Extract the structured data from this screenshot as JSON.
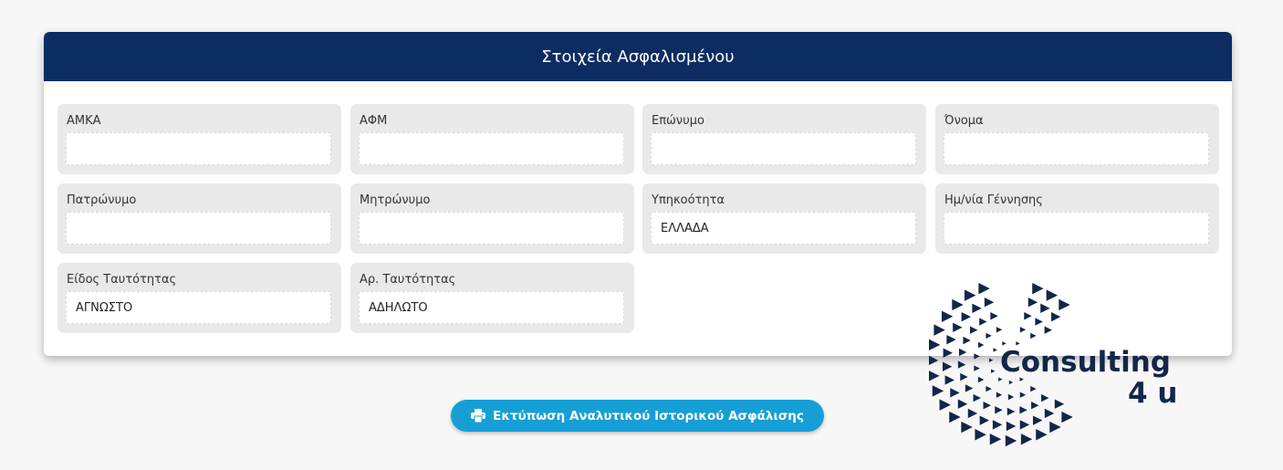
{
  "panel": {
    "title": "Στοιχεία Ασφαλισμένου"
  },
  "fields": [
    {
      "label": "ΑΜΚΑ",
      "value": ""
    },
    {
      "label": "ΑΦΜ",
      "value": ""
    },
    {
      "label": "Επώνυμο",
      "value": ""
    },
    {
      "label": "Όνομα",
      "value": ""
    },
    {
      "label": "Πατρώνυμο",
      "value": ""
    },
    {
      "label": "Μητρώνυμο",
      "value": ""
    },
    {
      "label": "Υπηκοότητα",
      "value": "ΕΛΛΑΔΑ"
    },
    {
      "label": "Ημ/νία Γέννησης",
      "value": ""
    },
    {
      "label": "Είδος Ταυτότητας",
      "value": "ΑΓΝΩΣΤΟ"
    },
    {
      "label": "Αρ. Ταυτότητας",
      "value": "ΑΔΗΛΩΤΟ"
    }
  ],
  "actions": {
    "print_label": "Εκτύπωση Αναλυτικού Ιστορικού Ασφάλισης",
    "print_icon": "printer-icon"
  },
  "logo": {
    "line1": "Consulting",
    "line2": "4 u"
  },
  "colors": {
    "header_bg": "#0d2d62",
    "button_bg": "#169fd6",
    "field_bg": "#e9e9e9",
    "logo": "#13264a"
  }
}
